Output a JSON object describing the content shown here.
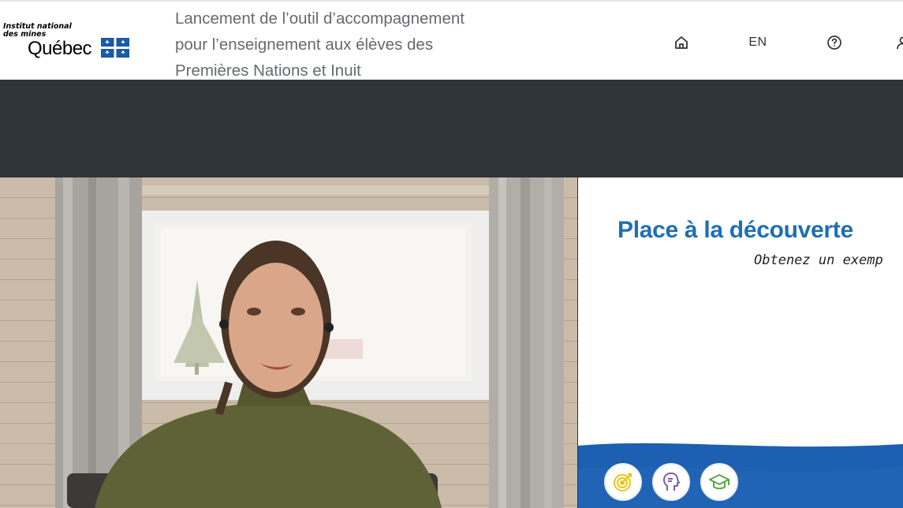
{
  "header": {
    "logo": {
      "line1": "Institut national",
      "line2": "des mines",
      "wordmark": "Québec"
    },
    "title_lines": [
      "Lancement de l’outil d’accompagnement",
      "pour l’enseignement aux élèves des",
      "Premières Nations et Inuit"
    ],
    "nav": {
      "home_icon": "home-icon",
      "language_label": "EN",
      "help_icon": "help-circle-icon",
      "user_icon": "user-icon"
    }
  },
  "slide": {
    "title": "Place à la découverte",
    "subtitle": "Obtenez un exemp",
    "icons": [
      "target-icon",
      "head-profile-icon",
      "graduation-cap-icon"
    ],
    "colors": {
      "title": "#1f6eb6",
      "wave": "#1d5fb0",
      "icon_yellow": "#e8c61a",
      "icon_purple": "#7b5ea7",
      "icon_green": "#5aa540"
    }
  },
  "colors": {
    "header_bg": "#ffffff",
    "title_text": "#666a6e",
    "band_bg": "#2f3438",
    "quebec_blue": "#1a5aa6"
  }
}
